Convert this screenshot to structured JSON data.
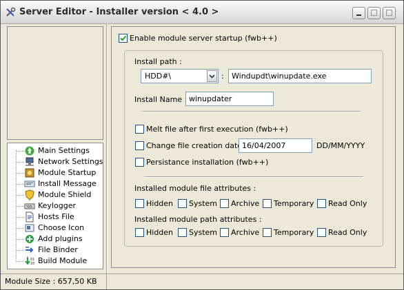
{
  "window": {
    "title": "Server Editor - Installer version < 4.0 >"
  },
  "tree": {
    "items": [
      {
        "label": "Main Settings",
        "icon": "main-settings-icon"
      },
      {
        "label": "Network Settings",
        "icon": "network-icon"
      },
      {
        "label": "Module Startup",
        "icon": "module-startup-icon"
      },
      {
        "label": "Install Message",
        "icon": "message-icon"
      },
      {
        "label": "Module Shield",
        "icon": "shield-icon"
      },
      {
        "label": "Keylogger",
        "icon": "keyboard-icon"
      },
      {
        "label": "Hosts File",
        "icon": "hosts-file-icon"
      },
      {
        "label": "Choose Icon",
        "icon": "choose-icon-icon"
      },
      {
        "label": "Add plugins",
        "icon": "plugin-icon"
      },
      {
        "label": "File Binder",
        "icon": "file-binder-icon"
      },
      {
        "label": "Build Module",
        "icon": "build-icon"
      }
    ]
  },
  "startup": {
    "enable_label": "Enable module server startup (fwb++)",
    "enable_checked": true,
    "install_path_label": "Install path :",
    "drive_value": "HDD#\\",
    "path_separator": ":",
    "path_value": "Windupdt\\winupdate.exe",
    "install_name_label": "Install Name :",
    "install_name_value": "winupdater",
    "melt_label": "Melt file after first execution (fwb++)",
    "change_date_label": "Change file creation date :",
    "date_value": "16/04/2007",
    "date_format": "DD/MM/YYYY",
    "persistance_label": "Persistance installation (fwb++)",
    "file_attr_title": "Installed module file attributes :",
    "path_attr_title": "Installed module path attributes :",
    "attributes": [
      "Hidden",
      "System",
      "Archive",
      "Temporary",
      "Read Only"
    ]
  },
  "status": {
    "module_size": "Module Size : 657,50 KB"
  },
  "colors": {
    "background": "#ece9d8",
    "check_mark": "#21a121",
    "border": "#7f9db9"
  }
}
